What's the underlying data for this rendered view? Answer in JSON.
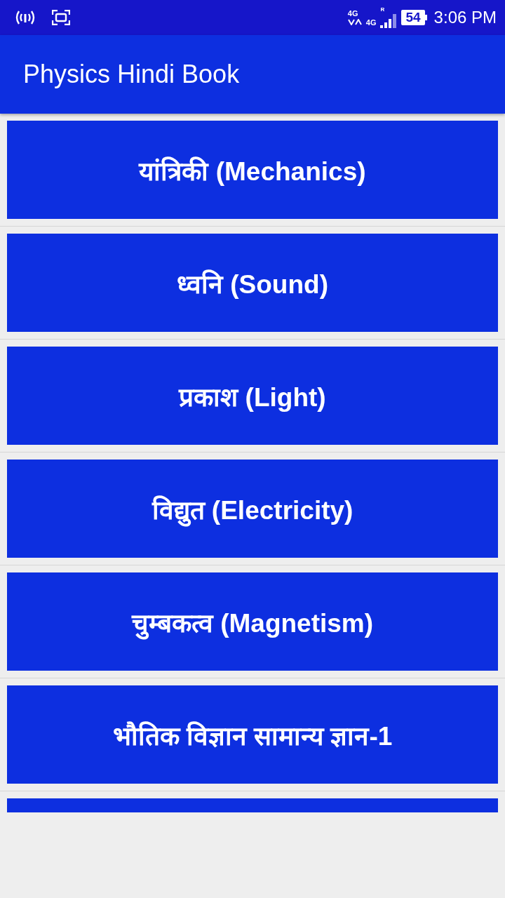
{
  "status_bar": {
    "network_labels": [
      "4G",
      "4G",
      "R"
    ],
    "battery": "54",
    "time": "3:06 PM"
  },
  "app_bar": {
    "title": "Physics Hindi Book"
  },
  "topics": [
    {
      "kind": "button",
      "label": "यांत्रिकी (Mechanics)"
    },
    {
      "kind": "button",
      "label": "ध्वनि (Sound)"
    },
    {
      "kind": "button",
      "label": "प्रकाश (Light)"
    },
    {
      "kind": "button",
      "label": "विद्युत (Electricity)"
    },
    {
      "kind": "button",
      "label": "चुम्बकत्व (Magnetism)"
    },
    {
      "kind": "button",
      "label": "भौतिक विज्ञान सामान्य ज्ञान-1"
    },
    {
      "kind": "cut-off"
    }
  ]
}
